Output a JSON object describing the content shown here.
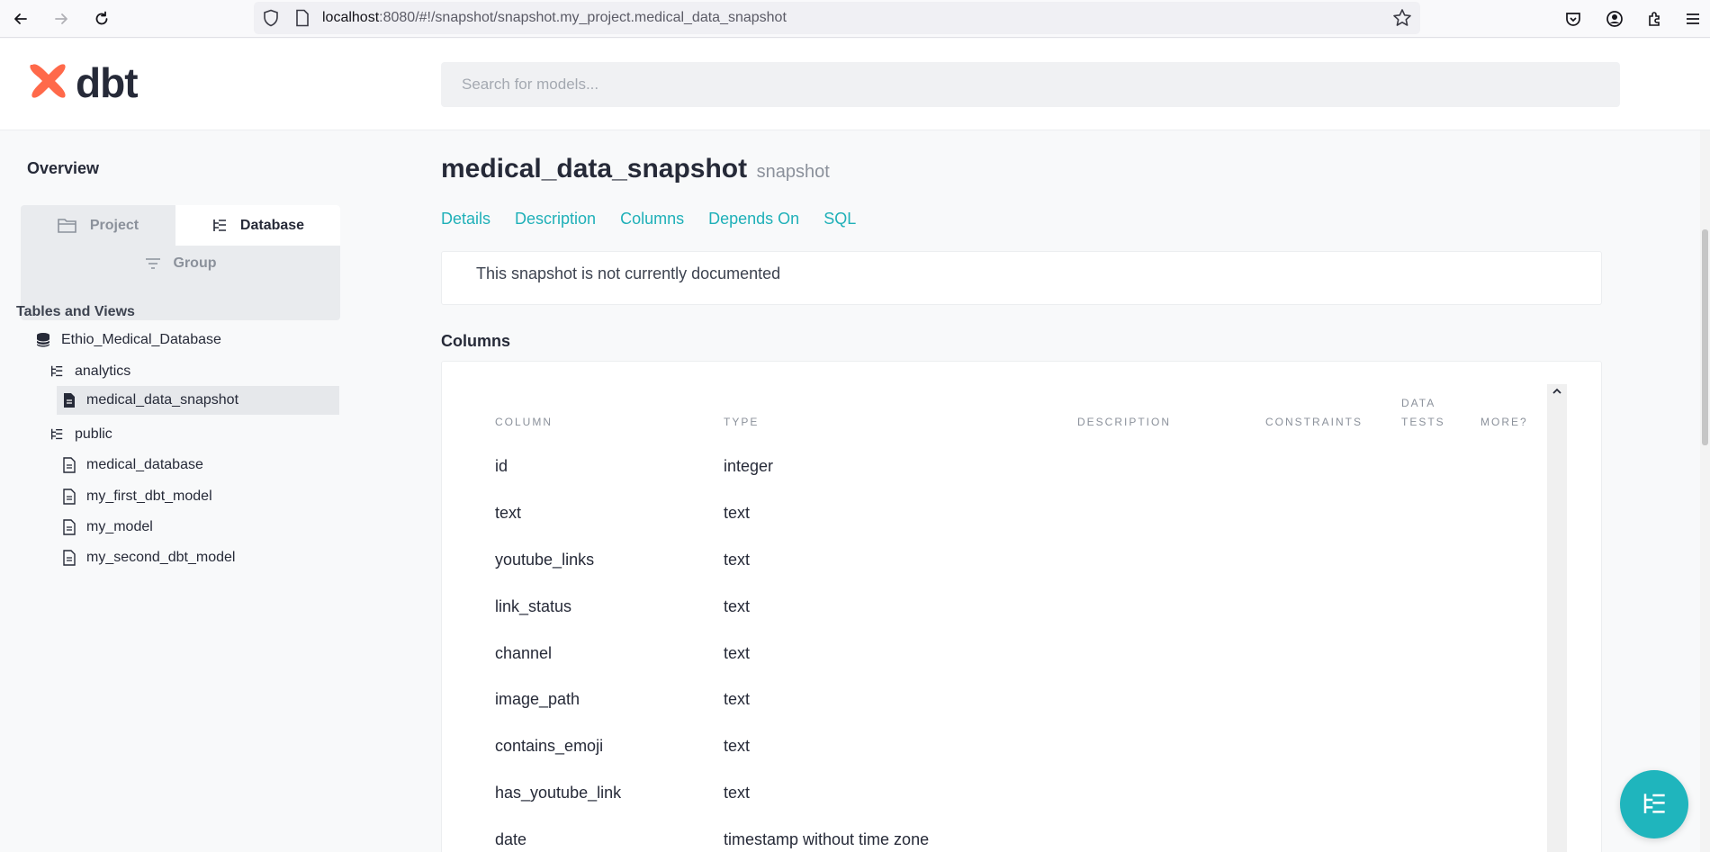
{
  "browser": {
    "url_host": "localhost",
    "url_rest": ":8080/#!/snapshot/snapshot.my_project.medical_data_snapshot"
  },
  "header": {
    "logo_text": "dbt",
    "search_placeholder": "Search for models..."
  },
  "sidebar": {
    "overview_label": "Overview",
    "switcher": {
      "project_label": "Project",
      "database_label": "Database",
      "group_label": "Group",
      "active": "Database"
    },
    "section_title": "Tables and Views",
    "tree": {
      "database": "Ethio_Medical_Database",
      "schema_analytics": "analytics",
      "analytics_items": [
        "medical_data_snapshot"
      ],
      "schema_public": "public",
      "public_items": [
        "medical_database",
        "my_first_dbt_model",
        "my_model",
        "my_second_dbt_model"
      ]
    }
  },
  "main": {
    "title": "medical_data_snapshot",
    "resource_type": "snapshot",
    "tabs": [
      "Details",
      "Description",
      "Columns",
      "Depends On",
      "SQL"
    ],
    "description_text": "This snapshot is not currently documented",
    "columns_heading": "Columns",
    "table_headers": {
      "column": "COLUMN",
      "type": "TYPE",
      "description": "DESCRIPTION",
      "constraints": "CONSTRAINTS",
      "data_tests_1": "DATA",
      "data_tests_2": "TESTS",
      "more": "MORE?"
    },
    "rows": [
      {
        "name": "id",
        "type": "integer"
      },
      {
        "name": "text",
        "type": "text"
      },
      {
        "name": "youtube_links",
        "type": "text"
      },
      {
        "name": "link_status",
        "type": "text"
      },
      {
        "name": "channel",
        "type": "text"
      },
      {
        "name": "image_path",
        "type": "text"
      },
      {
        "name": "contains_emoji",
        "type": "text"
      },
      {
        "name": "has_youtube_link",
        "type": "text"
      },
      {
        "name": "date",
        "type": "timestamp without time zone"
      }
    ]
  },
  "colors": {
    "accent": "#1fb0b8",
    "logo": "#ff694a",
    "text": "#262a38"
  }
}
